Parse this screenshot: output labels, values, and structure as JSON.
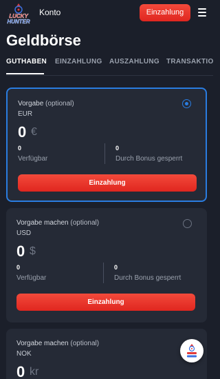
{
  "header": {
    "logo_text": "LUCKY HUNTER",
    "account_label": "Konto",
    "deposit_button": "Einzahlung"
  },
  "page": {
    "title": "Geldbörse"
  },
  "tabs": [
    {
      "label": "GUTHABEN",
      "active": true
    },
    {
      "label": "EINZAHLUNG",
      "active": false
    },
    {
      "label": "AUSZAHLUNG",
      "active": false
    },
    {
      "label": "TRANSAKTIO",
      "active": false
    }
  ],
  "wallets": [
    {
      "label_main": "Vorgabe",
      "label_optional": "(optional)",
      "currency": "EUR",
      "amount": "0",
      "symbol": "€",
      "available_value": "0",
      "available_label": "Verfügbar",
      "locked_value": "0",
      "locked_label": "Durch Bonus gesperrt",
      "button": "Einzahlung",
      "selected": true
    },
    {
      "label_main": "Vorgabe machen",
      "label_optional": "(optional)",
      "currency": "USD",
      "amount": "0",
      "symbol": "$",
      "available_value": "0",
      "available_label": "Verfügbar",
      "locked_value": "0",
      "locked_label": "Durch Bonus gesperrt",
      "button": "Einzahlung",
      "selected": false
    },
    {
      "label_main": "Vorgabe machen",
      "label_optional": "(optional)",
      "currency": "NOK",
      "amount": "0",
      "symbol": "kr",
      "selected": false
    }
  ],
  "colors": {
    "background": "#1b1f2a",
    "card": "#252a36",
    "accent_red": "#e83a2e",
    "selected_blue": "#2a7de1"
  },
  "icons": {
    "menu": "hamburger-menu-icon",
    "support": "support-chat-icon"
  }
}
